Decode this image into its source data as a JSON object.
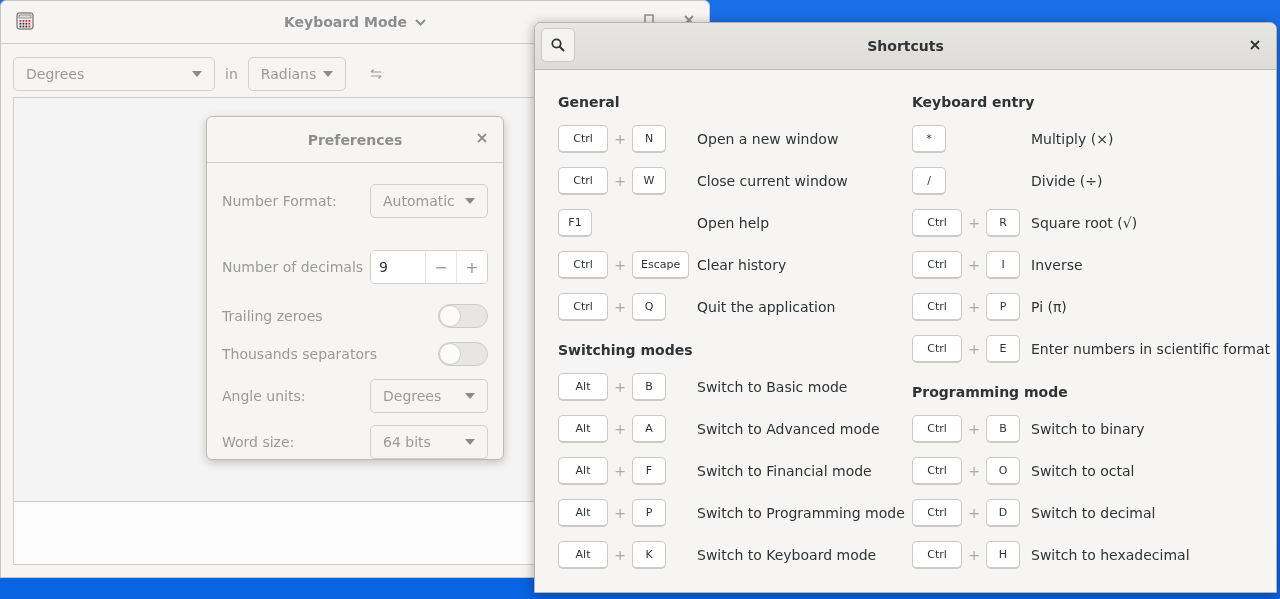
{
  "main_window": {
    "title": "Keyboard Mode",
    "from_unit": "Degrees",
    "in_label": "in",
    "to_unit": "Radians"
  },
  "preferences": {
    "title": "Preferences",
    "rows": [
      {
        "kind": "dropdown",
        "label": "Number Format:",
        "value": "Automatic"
      },
      {
        "kind": "spin",
        "label": "Number of decimals",
        "value": "9",
        "decrement": "−",
        "increment": "+"
      },
      {
        "kind": "switch",
        "label": "Trailing zeroes",
        "on": false
      },
      {
        "kind": "switch",
        "label": "Thousands separators",
        "on": false
      },
      {
        "kind": "dropdown",
        "label": "Angle units:",
        "value": "Degrees"
      },
      {
        "kind": "dropdown",
        "label": "Word size:",
        "value": "64 bits"
      }
    ]
  },
  "shortcuts": {
    "title": "Shortcuts",
    "columns": [
      {
        "sections": [
          {
            "title": "General",
            "items": [
              {
                "keys": [
                  "Ctrl",
                  "+",
                  "N"
                ],
                "description": "Open a new window"
              },
              {
                "keys": [
                  "Ctrl",
                  "+",
                  "W"
                ],
                "description": "Close current window"
              },
              {
                "keys": [
                  "F1"
                ],
                "description": "Open help"
              },
              {
                "keys": [
                  "Ctrl",
                  "+",
                  "Escape"
                ],
                "description": "Clear history"
              },
              {
                "keys": [
                  "Ctrl",
                  "+",
                  "Q"
                ],
                "description": "Quit the application"
              }
            ]
          },
          {
            "title": "Switching modes",
            "items": [
              {
                "keys": [
                  "Alt",
                  "+",
                  "B"
                ],
                "description": "Switch to Basic mode"
              },
              {
                "keys": [
                  "Alt",
                  "+",
                  "A"
                ],
                "description": "Switch to Advanced mode"
              },
              {
                "keys": [
                  "Alt",
                  "+",
                  "F"
                ],
                "description": "Switch to Financial mode"
              },
              {
                "keys": [
                  "Alt",
                  "+",
                  "P"
                ],
                "description": "Switch to Programming mode"
              },
              {
                "keys": [
                  "Alt",
                  "+",
                  "K"
                ],
                "description": "Switch to Keyboard mode"
              }
            ]
          }
        ]
      },
      {
        "sections": [
          {
            "title": "Keyboard entry",
            "items": [
              {
                "keys": [
                  "*"
                ],
                "description": "Multiply (×)"
              },
              {
                "keys": [
                  "/"
                ],
                "description": "Divide (÷)"
              },
              {
                "keys": [
                  "Ctrl",
                  "+",
                  "R"
                ],
                "description": "Square root (√)"
              },
              {
                "keys": [
                  "Ctrl",
                  "+",
                  "I"
                ],
                "description": "Inverse"
              },
              {
                "keys": [
                  "Ctrl",
                  "+",
                  "P"
                ],
                "description": "Pi (π)"
              },
              {
                "keys": [
                  "Ctrl",
                  "+",
                  "E"
                ],
                "description": "Enter numbers in scientific format"
              }
            ]
          },
          {
            "title": "Programming mode",
            "items": [
              {
                "keys": [
                  "Ctrl",
                  "+",
                  "B"
                ],
                "description": "Switch to binary"
              },
              {
                "keys": [
                  "Ctrl",
                  "+",
                  "O"
                ],
                "description": "Switch to octal"
              },
              {
                "keys": [
                  "Ctrl",
                  "+",
                  "D"
                ],
                "description": "Switch to decimal"
              },
              {
                "keys": [
                  "Ctrl",
                  "+",
                  "H"
                ],
                "description": "Switch to hexadecimal"
              }
            ]
          }
        ]
      }
    ]
  }
}
